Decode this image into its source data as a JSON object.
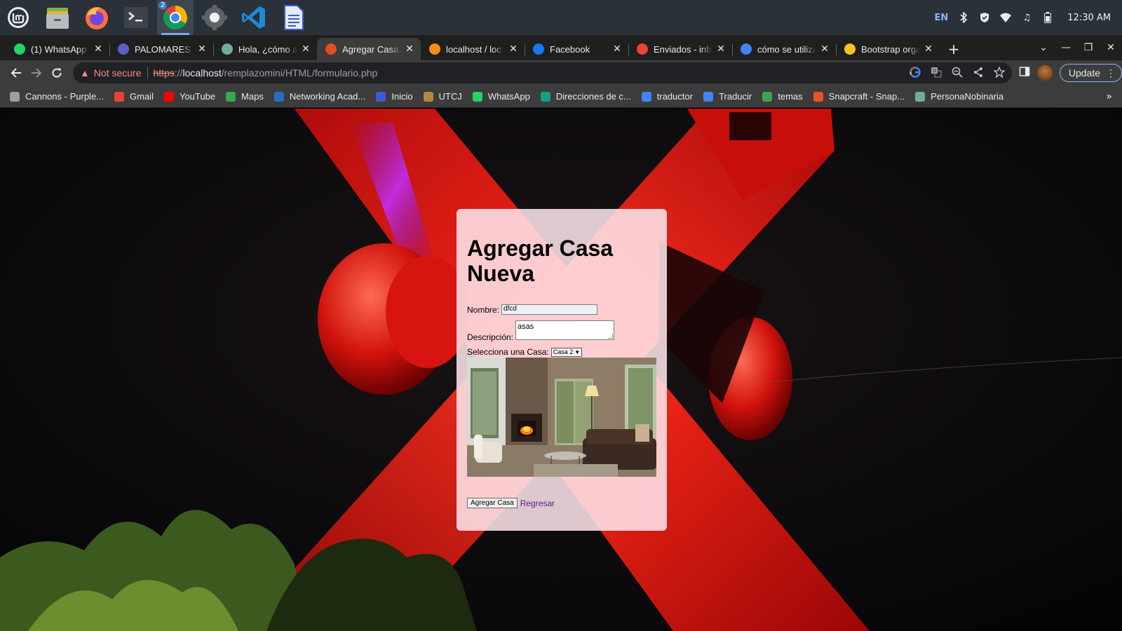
{
  "taskbar": {
    "apps": [
      {
        "name": "mint-menu-icon"
      },
      {
        "name": "files-icon"
      },
      {
        "name": "firefox-icon"
      },
      {
        "name": "terminal-icon"
      },
      {
        "name": "chrome-icon",
        "badge": "2"
      },
      {
        "name": "settings-icon"
      },
      {
        "name": "vscode-icon"
      },
      {
        "name": "text-editor-icon"
      }
    ],
    "language": "EN",
    "clock": "12:30 AM"
  },
  "tabs": [
    {
      "title": "(1) WhatsApp",
      "icon": "whatsapp-icon",
      "color": "#25d366",
      "active": false
    },
    {
      "title": "PALOMARES O",
      "icon": "teams-icon",
      "color": "#5b5fc7",
      "active": false
    },
    {
      "title": "Hola, ¿cómo ay",
      "icon": "chatgpt-icon",
      "color": "#74aa9c",
      "active": false
    },
    {
      "title": "Agregar Casa",
      "icon": "html-icon",
      "color": "#e44d26",
      "active": true
    },
    {
      "title": "localhost / loc",
      "icon": "phpmyadmin-icon",
      "color": "#f29111",
      "active": false
    },
    {
      "title": "Facebook",
      "icon": "facebook-icon",
      "color": "#1877f2",
      "active": false
    },
    {
      "title": "Enviados - inbo",
      "icon": "gmail-icon",
      "color": "#ea4335",
      "active": false
    },
    {
      "title": "cómo se utiliza",
      "icon": "google-icon",
      "color": "#4285f4",
      "active": false
    },
    {
      "title": "Bootstrap orga",
      "icon": "bootstrap-icon",
      "color": "#f5c518",
      "active": false
    }
  ],
  "address": {
    "security_label": "Not secure",
    "url_scheme": "https",
    "url_sep": "://",
    "url_host": "localhost",
    "url_path": "/remplazomini/HTML/formulario.php",
    "update_label": "Update"
  },
  "bookmarks": [
    {
      "label": "Cannons - Purple...",
      "icon": "globe-icon",
      "color": "#9aa0a6"
    },
    {
      "label": "Gmail",
      "icon": "gmail-icon",
      "color": "#ea4335"
    },
    {
      "label": "YouTube",
      "icon": "youtube-icon",
      "color": "#ff0000"
    },
    {
      "label": "Maps",
      "icon": "maps-icon",
      "color": "#34a853"
    },
    {
      "label": "Networking Acad...",
      "icon": "cisco-icon",
      "color": "#2a6ebb"
    },
    {
      "label": "Inicio",
      "icon": "inicio-icon",
      "color": "#3b5bdb"
    },
    {
      "label": "UTCJ",
      "icon": "utcj-icon",
      "color": "#b08a3c"
    },
    {
      "label": "WhatsApp",
      "icon": "whatsapp-icon",
      "color": "#25d366"
    },
    {
      "label": "Direcciones de c...",
      "icon": "direcciones-icon",
      "color": "#14a085"
    },
    {
      "label": "traductor",
      "icon": "google-icon",
      "color": "#4285f4"
    },
    {
      "label": "Traducir",
      "icon": "translate-icon",
      "color": "#4285f4"
    },
    {
      "label": "temas",
      "icon": "temas-icon",
      "color": "#3fa34d"
    },
    {
      "label": "Snapcraft - Snap...",
      "icon": "snapcraft-icon",
      "color": "#e95420"
    },
    {
      "label": "PersonaNobinaria",
      "icon": "chatgpt-icon",
      "color": "#74aa9c"
    }
  ],
  "form": {
    "heading": "Agregar Casa Nueva",
    "nombre_label": "Nombre:",
    "nombre_value": "dfcd",
    "descripcion_label": "Descripción:",
    "descripcion_value": "asas",
    "selecciona_label": "Selecciona una Casa:",
    "selected_casa": "Casa 2",
    "submit_label": "Agregar Casa",
    "back_link": "Regresar"
  }
}
